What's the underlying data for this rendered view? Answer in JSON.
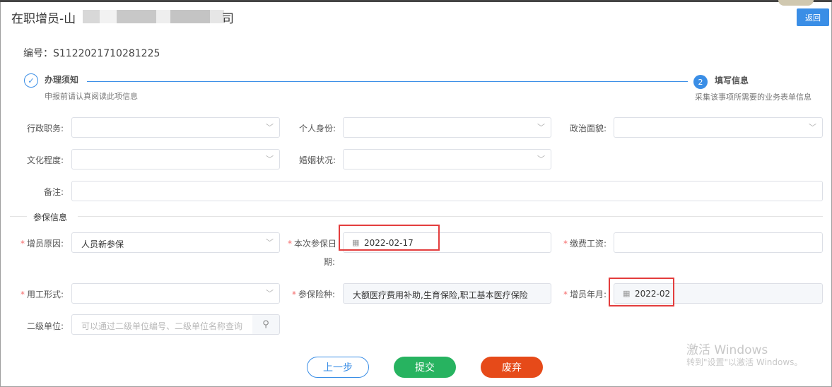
{
  "dialog": {
    "title": "在职增员-山",
    "title_tail": "司",
    "back_label": "返回",
    "serial": "编号：S1122021710281225"
  },
  "steps": [
    {
      "title": "办理须知",
      "subtitle": "申报前请认真阅读此项信息",
      "state": "done",
      "icon": "check-icon"
    },
    {
      "number": "2",
      "title": "填写信息",
      "subtitle": "采集该事项所需要的业务表单信息",
      "state": "active"
    }
  ],
  "form": {
    "admin_position": {
      "label": "行政职务:",
      "value": ""
    },
    "personal_identity": {
      "label": "个人身份:",
      "value": ""
    },
    "political_status": {
      "label": "政治面貌:",
      "value": ""
    },
    "education": {
      "label": "文化程度:",
      "value": ""
    },
    "marital_status": {
      "label": "婚姻状况:",
      "value": ""
    },
    "remarks": {
      "label": "备注:",
      "value": ""
    }
  },
  "insurance": {
    "section_title": "参保信息",
    "reason": {
      "label": "增员原因:",
      "value": "人员新参保",
      "required": true
    },
    "date_line1": "本次参保日",
    "date_line2": "期:",
    "date_value": "2022-02-17",
    "salary": {
      "label": "缴费工资:",
      "value": "",
      "required": true
    },
    "employment_type": {
      "label": "用工形式:",
      "value": "",
      "required": true
    },
    "insurance_types": {
      "label": "参保险种:",
      "value": "大额医疗费用补助,生育保险,职工基本医疗保险",
      "required": true
    },
    "month": {
      "label": "增员年月:",
      "value": "2022-02",
      "required": true
    },
    "sub_unit": {
      "label": "二级单位:",
      "placeholder": "可以通过二级单位编号、二级单位名称查询"
    }
  },
  "buttons": {
    "prev": "上一步",
    "submit": "提交",
    "discard": "废弃"
  },
  "watermark": {
    "line1": "激活 Windows",
    "line2": "转到\"设置\"以激活 Windows。"
  },
  "colors": {
    "primary": "#3a8ee6",
    "submit": "#27b360",
    "discard": "#e64a19",
    "highlight": "#e33d3d",
    "required": "#f56c6c"
  }
}
